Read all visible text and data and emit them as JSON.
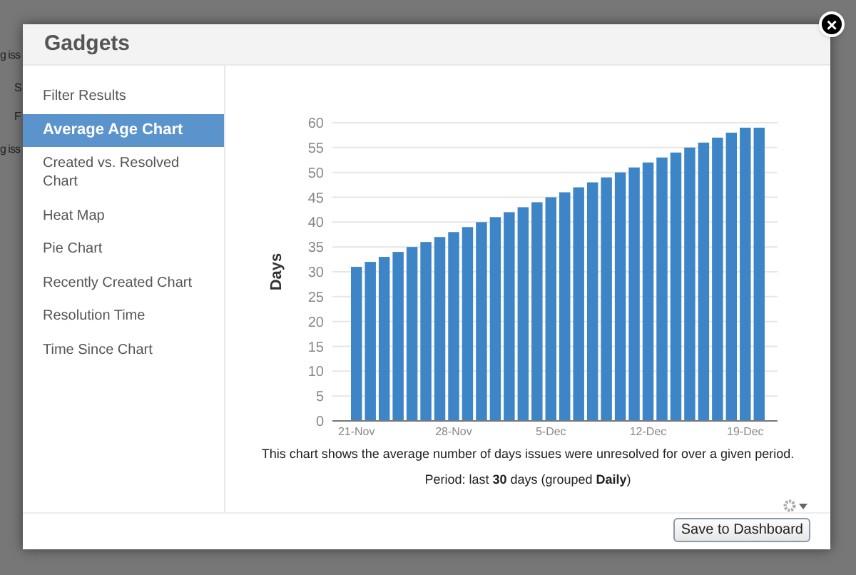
{
  "background_fragments": [
    "g iss",
    "S",
    "F",
    "g iss"
  ],
  "dialog": {
    "title": "Gadgets",
    "close_icon": "×"
  },
  "sidebar": {
    "items": [
      {
        "label": "Filter Results",
        "selected": false
      },
      {
        "label": "Average Age Chart",
        "selected": true
      },
      {
        "label": "Created vs. Resolved Chart",
        "selected": false
      },
      {
        "label": "Heat Map",
        "selected": false
      },
      {
        "label": "Pie Chart",
        "selected": false
      },
      {
        "label": "Recently Created Chart",
        "selected": false
      },
      {
        "label": "Resolution Time",
        "selected": false
      },
      {
        "label": "Time Since Chart",
        "selected": false
      }
    ]
  },
  "gadget": {
    "chart_data": {
      "type": "bar",
      "ylabel": "Days",
      "grid": true,
      "categories": [
        "21-Nov",
        null,
        null,
        null,
        null,
        null,
        null,
        "28-Nov",
        null,
        null,
        null,
        null,
        null,
        null,
        "5-Dec",
        null,
        null,
        null,
        null,
        null,
        null,
        "12-Dec",
        null,
        null,
        null,
        null,
        null,
        null,
        "19-Dec",
        null
      ],
      "series": [
        {
          "color": "#3d85c6",
          "values": [
            31,
            32,
            33,
            34,
            35,
            36,
            37,
            38,
            39,
            40,
            41,
            42,
            43,
            44,
            45,
            46,
            47,
            48,
            49,
            50,
            51,
            52,
            53,
            54,
            55,
            56,
            57,
            58,
            59,
            59
          ]
        }
      ],
      "ylim": [
        0,
        60
      ],
      "yticks": [
        0,
        5,
        10,
        15,
        20,
        25,
        30,
        35,
        40,
        45,
        50,
        55,
        60
      ]
    },
    "description": "This chart shows the average number of days issues were unresolved for over a given period.",
    "period": "Period: last **30** days (grouped **Daily**)"
  },
  "footer": {
    "button": "Save to Dashboard"
  }
}
